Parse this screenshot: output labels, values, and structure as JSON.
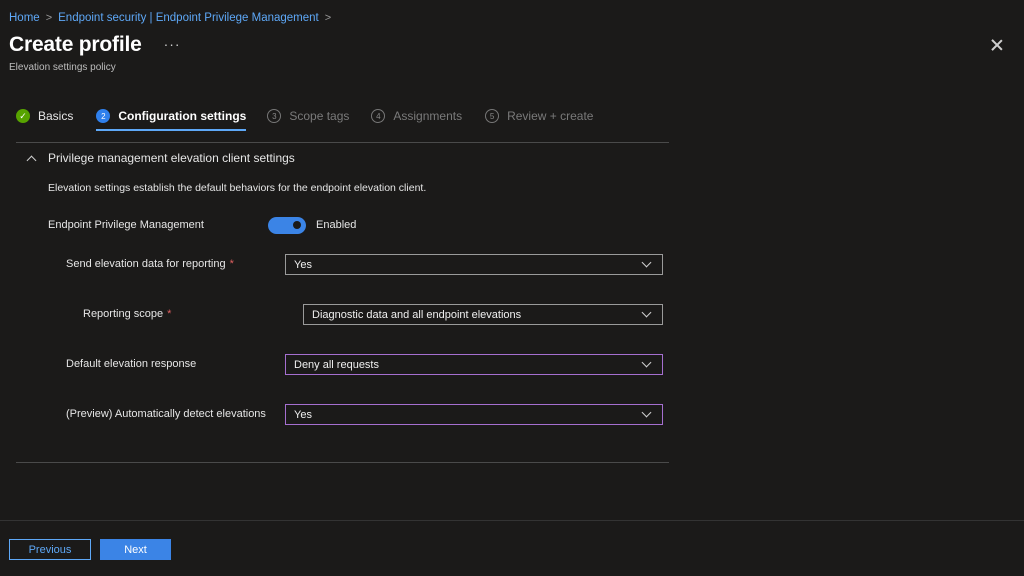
{
  "breadcrumb": {
    "items": [
      "Home",
      "Endpoint security | Endpoint Privilege Management"
    ]
  },
  "header": {
    "title": "Create profile",
    "more": "···",
    "subtitle": "Elevation settings policy"
  },
  "wizard": {
    "steps": [
      {
        "number": "✓",
        "label": "Basics",
        "state": "done"
      },
      {
        "number": "2",
        "label": "Configuration settings",
        "state": "current"
      },
      {
        "number": "3",
        "label": "Scope tags",
        "state": "pending"
      },
      {
        "number": "4",
        "label": "Assignments",
        "state": "pending"
      },
      {
        "number": "5",
        "label": "Review + create",
        "state": "pending"
      }
    ]
  },
  "section": {
    "title": "Privilege management elevation client settings",
    "description": "Elevation settings establish the default behaviors for the endpoint elevation client.",
    "toggle": {
      "label": "Endpoint Privilege Management",
      "state": "Enabled"
    },
    "fields": [
      {
        "label": "Send elevation data for reporting",
        "required": "*",
        "value": "Yes"
      },
      {
        "label": "Reporting scope",
        "required": "*",
        "value": "Diagnostic data and all endpoint elevations"
      },
      {
        "label": "Default elevation response",
        "required": "",
        "value": "Deny all requests"
      },
      {
        "label": "(Preview) Automatically detect elevations",
        "required": "",
        "value": "Yes"
      }
    ]
  },
  "footer": {
    "previous_label": "Previous",
    "next_label": "Next"
  },
  "colors": {
    "background": "#1b1a19",
    "link": "#5ea8f7",
    "accent": "#3b84e6",
    "done": "#57a300",
    "focus": "#a56fd0",
    "required": "#e06060"
  }
}
